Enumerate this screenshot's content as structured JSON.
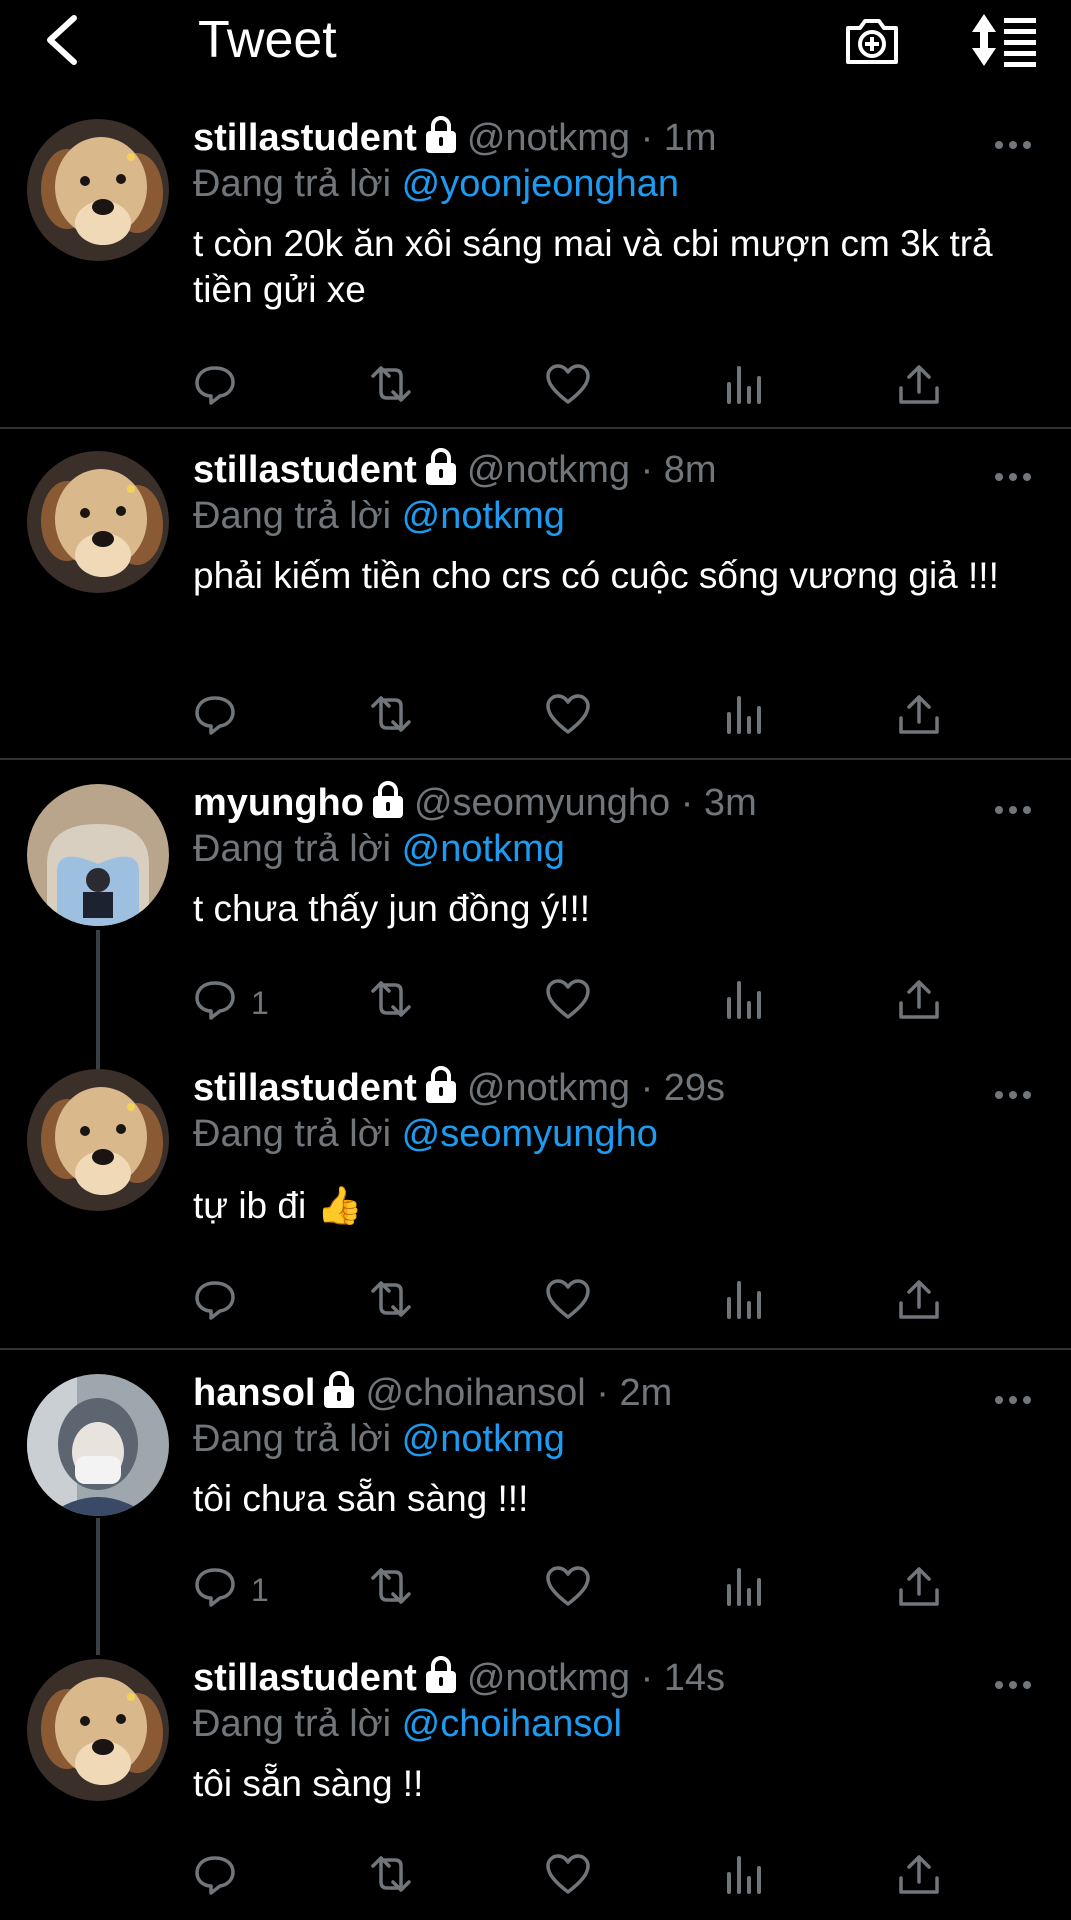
{
  "header": {
    "title": "Tweet"
  },
  "colors": {
    "background": "#000000",
    "link": "#1d9bf0",
    "muted": "#71767b",
    "divider": "#2f3336"
  },
  "icons": {
    "back": "chevron-left-icon",
    "camera": "camera-plus-icon",
    "sort": "sort-icon",
    "more": "more-horizontal-icon",
    "reply": "reply-icon",
    "retweet": "retweet-icon",
    "like": "heart-icon",
    "analytics": "analytics-icon",
    "share": "share-icon",
    "lock": "lock-icon"
  },
  "tweets": [
    {
      "name": "stillastudent",
      "handle": "@notkmg",
      "time": "· 1m",
      "reply_prefix": "Đang trả lời",
      "reply_to": "@yoonjeonghan",
      "text": "t còn 20k ăn xôi sáng mai và cbi mượn cm 3k trả tiền gửi xe",
      "reply_count": ""
    },
    {
      "name": "stillastudent",
      "handle": "@notkmg",
      "time": "· 8m",
      "reply_prefix": "Đang trả lời",
      "reply_to": "@notkmg",
      "text": "phải kiếm tiền cho crs có cuộc sống vương giả !!!",
      "reply_count": ""
    },
    {
      "name": "myungho",
      "handle": "@seomyungho",
      "time": "· 3m",
      "reply_prefix": "Đang trả lời",
      "reply_to": "@notkmg",
      "text": "t chưa thấy jun đồng ý!!!",
      "reply_count": "1"
    },
    {
      "name": "stillastudent",
      "handle": "@notkmg",
      "time": "· 29s",
      "reply_prefix": "Đang trả lời",
      "reply_to": "@seomyungho",
      "text": "tự ib đi 👍",
      "reply_count": ""
    },
    {
      "name": "hansol",
      "handle": "@choihansol",
      "time": "· 2m",
      "reply_prefix": "Đang trả lời",
      "reply_to": "@notkmg",
      "text": "tôi chưa sẵn sàng !!!",
      "reply_count": "1"
    },
    {
      "name": "stillastudent",
      "handle": "@notkmg",
      "time": "· 14s",
      "reply_prefix": "Đang trả lời",
      "reply_to": "@choihansol",
      "text": "tôi sẵn sàng !!",
      "reply_count": ""
    }
  ]
}
